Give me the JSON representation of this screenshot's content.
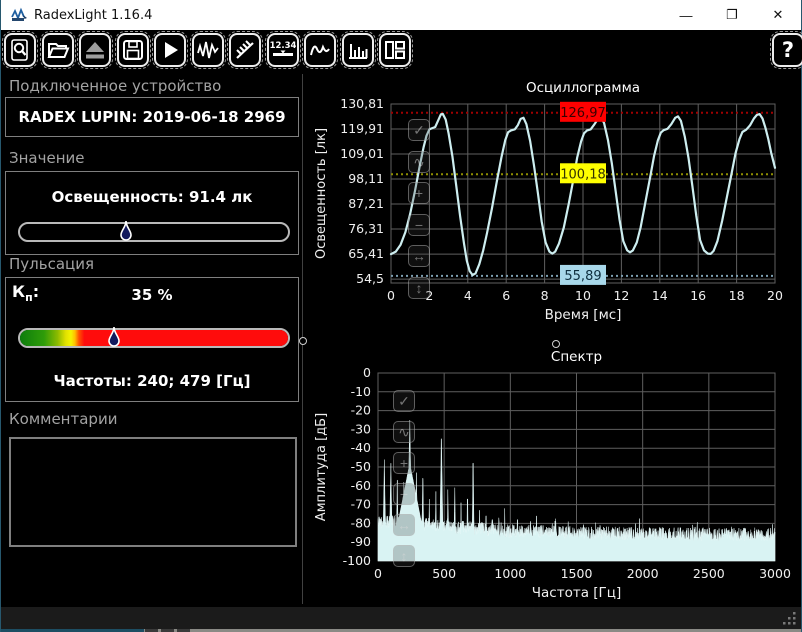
{
  "window": {
    "title": "RadexLight 1.16.4",
    "controls": {
      "minimize": "—",
      "maximize": "❐",
      "close": "✕"
    }
  },
  "toolbar": {
    "icons": [
      "search-document-icon",
      "open-folder-icon",
      "eject-icon",
      "save-icon",
      "play-icon",
      "oscillogram-icon",
      "tilt-hatch-icon",
      "numeric-display-icon",
      "curve-icon",
      "histogram-icon",
      "layout-icon"
    ],
    "numeric_label": "12.34",
    "help_label": "?"
  },
  "device_section": {
    "header": "Подключенное устройство",
    "device": "RADEX LUPIN: 2019-06-18 2969"
  },
  "value_section": {
    "header": "Значение",
    "value_label": "Освещенность: 91.4 лк",
    "marker_pos_pct": 39.5
  },
  "pulsation_section": {
    "header": "Пульсация",
    "kp_main": "К",
    "kp_sub": "п",
    "kp_colon": ":",
    "value": "35 %",
    "marker_pos_pct": 35,
    "frequencies": "Частоты: 240; 479 [Гц]"
  },
  "comments_section": {
    "header": "Комментарии",
    "text": ""
  },
  "chart_toolbar": {
    "buttons": [
      {
        "name": "chart-settings",
        "glyph": "✓"
      },
      {
        "name": "chart-curve",
        "glyph": "∿"
      },
      {
        "name": "chart-zoom-in",
        "glyph": "+"
      },
      {
        "name": "chart-zoom-out",
        "glyph": "−"
      },
      {
        "name": "chart-fit-horizontal",
        "glyph": "↔"
      },
      {
        "name": "chart-fit-vertical",
        "glyph": "↕"
      }
    ]
  },
  "chart_data": [
    {
      "type": "line",
      "title": "Осциллограмма",
      "xlabel": "Время [мс]",
      "ylabel": "Освещенность [лк]",
      "xlim": [
        0,
        20
      ],
      "ylim": [
        52.8,
        130.81
      ],
      "xticks": [
        0,
        2,
        4,
        6,
        8,
        10,
        12,
        14,
        16,
        18,
        20
      ],
      "yticks": [
        {
          "v": 130.81,
          "label": "130,81"
        },
        {
          "v": 119.91,
          "label": "119,91"
        },
        {
          "v": 109.01,
          "label": "109,01"
        },
        {
          "v": 98.11,
          "label": "98,11"
        },
        {
          "v": 87.21,
          "label": "87,21"
        },
        {
          "v": 76.31,
          "label": "76,31"
        },
        {
          "v": 65.41,
          "label": "65,41"
        },
        {
          "v": 54.5,
          "label": "54,5"
        }
      ],
      "grid": true,
      "line_color": "#cdeef0",
      "thresholds": [
        {
          "value": 126.97,
          "label": "126,97",
          "box_color": "#ff0000",
          "line_color": "#a00000",
          "text_color": "#3a0000"
        },
        {
          "value": 100.18,
          "label": "100,18",
          "box_color": "#ffff00",
          "line_color": "#8f8f00",
          "text_color": "#333300"
        },
        {
          "value": 55.89,
          "label": "55,89",
          "box_color": "#a8d8ea",
          "line_color": "#7d9fb2",
          "text_color": "#0f2f3f"
        }
      ],
      "points": [
        [
          0,
          65.4
        ],
        [
          0.25,
          66.5
        ],
        [
          0.5,
          69.5
        ],
        [
          0.75,
          75
        ],
        [
          1,
          83
        ],
        [
          1.25,
          93
        ],
        [
          1.5,
          104
        ],
        [
          1.7,
          112
        ],
        [
          1.85,
          117
        ],
        [
          2,
          119.8
        ],
        [
          2.15,
          120.3
        ],
        [
          2.3,
          120.8
        ],
        [
          2.45,
          123.5
        ],
        [
          2.6,
          126.3
        ],
        [
          2.7,
          126.5
        ],
        [
          2.85,
          124
        ],
        [
          3,
          118
        ],
        [
          3.2,
          108
        ],
        [
          3.4,
          95
        ],
        [
          3.6,
          82
        ],
        [
          3.8,
          70
        ],
        [
          3.95,
          62.5
        ],
        [
          4.1,
          58
        ],
        [
          4.25,
          56.3
        ],
        [
          4.4,
          57
        ],
        [
          4.6,
          61
        ],
        [
          4.8,
          67
        ],
        [
          5,
          74.5
        ],
        [
          5.25,
          85
        ],
        [
          5.5,
          96.5
        ],
        [
          5.75,
          107.5
        ],
        [
          5.95,
          115
        ],
        [
          6.1,
          118.5
        ],
        [
          6.25,
          119.3
        ],
        [
          6.45,
          119.8
        ],
        [
          6.6,
          121.5
        ],
        [
          6.75,
          124.3
        ],
        [
          6.9,
          124.8
        ],
        [
          7.05,
          122
        ],
        [
          7.25,
          114.5
        ],
        [
          7.45,
          104
        ],
        [
          7.65,
          92
        ],
        [
          7.85,
          79.5
        ],
        [
          8.05,
          70.5
        ],
        [
          8.25,
          66.5
        ],
        [
          8.4,
          65.6
        ],
        [
          8.55,
          66.5
        ],
        [
          8.75,
          70
        ],
        [
          9,
          77
        ],
        [
          9.25,
          87
        ],
        [
          9.5,
          98
        ],
        [
          9.7,
          107.5
        ],
        [
          9.9,
          114.5
        ],
        [
          10.05,
          118
        ],
        [
          10.2,
          119.2
        ],
        [
          10.4,
          119.8
        ],
        [
          10.6,
          122
        ],
        [
          10.8,
          124.6
        ],
        [
          10.95,
          125
        ],
        [
          11.1,
          122.5
        ],
        [
          11.3,
          115
        ],
        [
          11.5,
          105
        ],
        [
          11.7,
          93
        ],
        [
          11.9,
          80.5
        ],
        [
          12.1,
          71
        ],
        [
          12.3,
          67
        ],
        [
          12.45,
          66.2
        ],
        [
          12.6,
          67
        ],
        [
          12.8,
          70.5
        ],
        [
          13,
          77
        ],
        [
          13.25,
          88
        ],
        [
          13.5,
          99
        ],
        [
          13.7,
          108
        ],
        [
          13.9,
          115
        ],
        [
          14.05,
          118.3
        ],
        [
          14.2,
          119.4
        ],
        [
          14.4,
          120
        ],
        [
          14.6,
          122
        ],
        [
          14.8,
          124.8
        ],
        [
          14.95,
          125.4
        ],
        [
          15.1,
          123.5
        ],
        [
          15.3,
          116.5
        ],
        [
          15.5,
          107
        ],
        [
          15.7,
          95
        ],
        [
          15.9,
          82
        ],
        [
          16.1,
          71.5
        ],
        [
          16.3,
          67
        ],
        [
          16.5,
          65.6
        ],
        [
          16.65,
          65.5
        ],
        [
          16.8,
          66.8
        ],
        [
          17,
          71
        ],
        [
          17.25,
          80
        ],
        [
          17.5,
          90.5
        ],
        [
          17.75,
          101
        ],
        [
          17.95,
          109.5
        ],
        [
          18.15,
          115.5
        ],
        [
          18.3,
          118.6
        ],
        [
          18.5,
          119.6
        ],
        [
          18.7,
          121.5
        ],
        [
          18.9,
          124.5
        ],
        [
          19.05,
          126
        ],
        [
          19.2,
          126.4
        ],
        [
          19.35,
          124.5
        ],
        [
          19.5,
          120.5
        ],
        [
          19.65,
          115.5
        ],
        [
          19.8,
          109.5
        ],
        [
          20,
          103
        ]
      ]
    },
    {
      "type": "area",
      "title": "Спектр",
      "xlabel": "Частота [Гц]",
      "ylabel": "Амплитуда [дБ]",
      "xlim": [
        0,
        3000
      ],
      "ylim": [
        -100,
        0
      ],
      "xticks": [
        0,
        500,
        1000,
        1500,
        2000,
        2500,
        3000
      ],
      "yticks": [
        0,
        -10,
        -20,
        -30,
        -40,
        -50,
        -60,
        -70,
        -80,
        -90,
        -100
      ],
      "grid": true,
      "fill_color": "#d9f3f3",
      "noise_floor": [
        [
          0,
          -79
        ],
        [
          300,
          -80
        ],
        [
          600,
          -82
        ],
        [
          1000,
          -84
        ],
        [
          1500,
          -85
        ],
        [
          2000,
          -85.5
        ],
        [
          3000,
          -86
        ]
      ],
      "peaks": [
        [
          48,
          -46,
          6
        ],
        [
          97,
          -48,
          6
        ],
        [
          146,
          -57,
          6
        ],
        [
          195,
          -58,
          6
        ],
        [
          240,
          -25,
          7
        ],
        [
          240,
          -48,
          70
        ],
        [
          290,
          -53,
          6
        ],
        [
          339,
          -56,
          6
        ],
        [
          388,
          -67,
          5
        ],
        [
          437,
          -63,
          5
        ],
        [
          479,
          -35,
          6
        ],
        [
          528,
          -62,
          5
        ],
        [
          580,
          -61,
          5
        ],
        [
          628,
          -69,
          4
        ],
        [
          676,
          -67,
          4
        ],
        [
          719,
          -48,
          5
        ],
        [
          768,
          -73,
          4
        ],
        [
          816,
          -76,
          4
        ],
        [
          864,
          -78,
          3
        ],
        [
          912,
          -77,
          3
        ],
        [
          958,
          -72,
          4
        ],
        [
          1054,
          -78,
          3
        ],
        [
          1198,
          -76,
          3
        ],
        [
          1318,
          -80,
          3
        ],
        [
          1437,
          -79,
          3
        ],
        [
          1677,
          -81,
          3
        ],
        [
          1917,
          -82,
          3
        ],
        [
          2157,
          -83,
          3
        ],
        [
          2396,
          -82,
          3
        ],
        [
          2636,
          -84,
          3
        ],
        [
          2876,
          -84,
          3
        ]
      ]
    }
  ]
}
